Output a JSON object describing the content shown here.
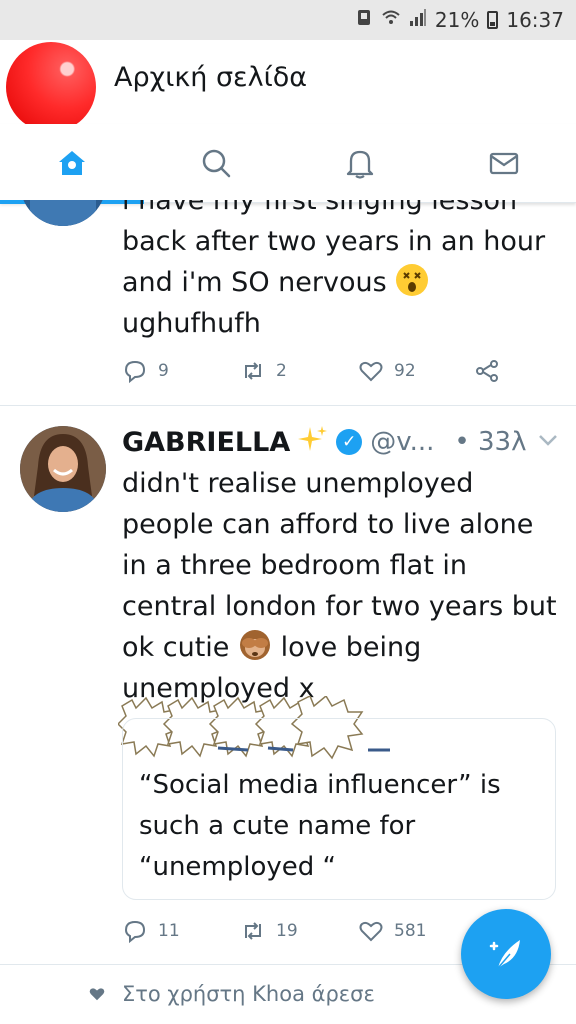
{
  "status_bar": {
    "battery": "21%",
    "time": "16:37"
  },
  "header": {
    "title": "Αρχική σελίδα"
  },
  "tabs": [
    {
      "name": "home",
      "icon": "home-icon",
      "active": true
    },
    {
      "name": "search",
      "icon": "search-icon",
      "active": false
    },
    {
      "name": "notifications",
      "icon": "bell-icon",
      "active": false
    },
    {
      "name": "messages",
      "icon": "mail-icon",
      "active": false
    }
  ],
  "tweets": [
    {
      "text_cut": "i have my first singing lesson",
      "text": "back after two years in an hour and i'm SO nervous",
      "text_tail": "ughufhufh",
      "replies": "9",
      "retweets": "2",
      "likes": "92"
    },
    {
      "display_name": "GABRIELLA",
      "handle": "@v...",
      "time": "• 33λ",
      "text": "didn't realise unemployed people can afford to live alone in a three bedroom flat in central london for two years but ok cutie",
      "text_after_emoji": "love being unemployed x",
      "quote": "“Social media influencer” is such a cute name for “unemployed “",
      "replies": "11",
      "retweets": "19",
      "likes": "581"
    }
  ],
  "footer_note": "Στο χρήστη Khoa άρεσε",
  "colors": {
    "accent": "#1da1f2",
    "text": "#14171a",
    "muted": "#657786"
  }
}
